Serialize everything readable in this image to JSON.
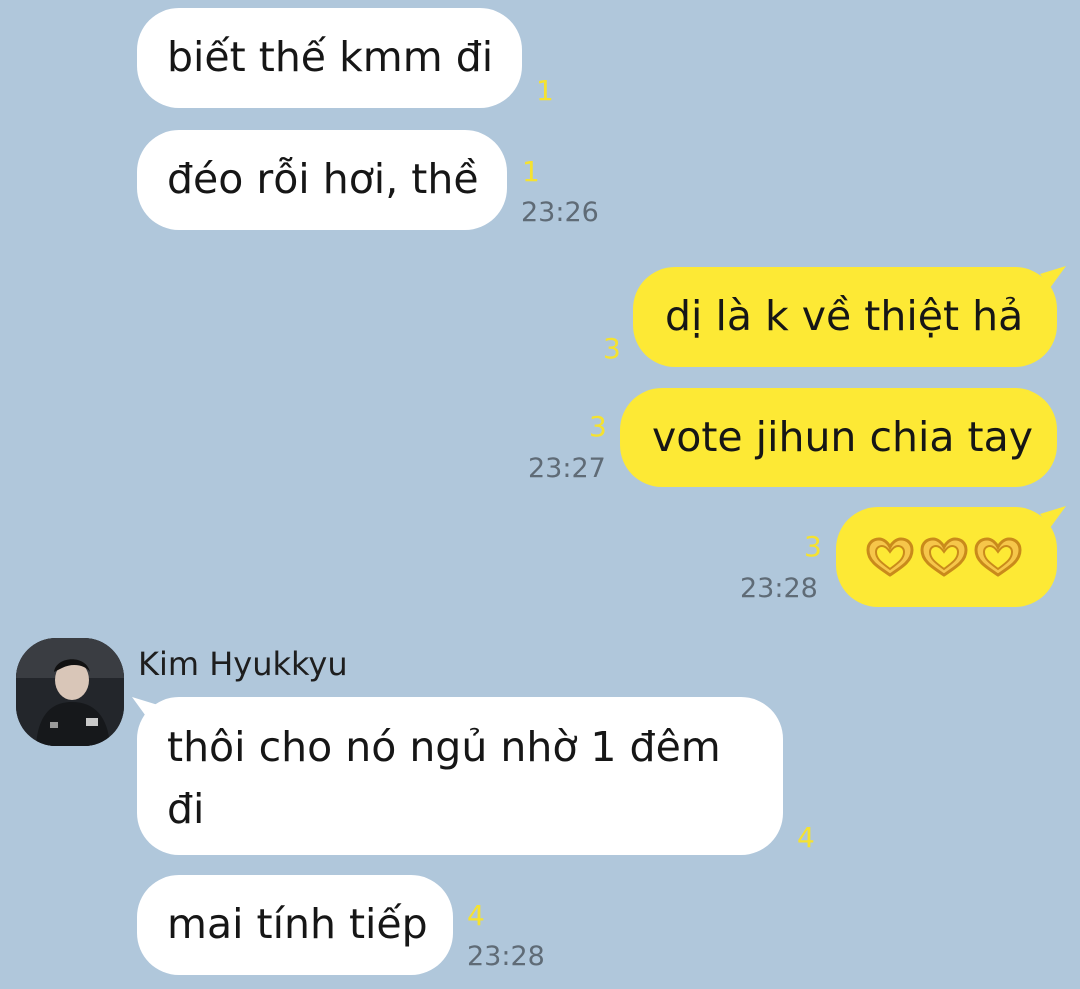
{
  "chat": {
    "messages": [
      {
        "text": "biết thế kmm đi",
        "unread": "1"
      },
      {
        "text": "đéo rỗi hơi, thề",
        "unread": "1",
        "time": "23:26"
      },
      {
        "text": "dị là k về thiệt hả",
        "unread": "3"
      },
      {
        "text": "vote jihun chia tay",
        "unread": "3",
        "time": "23:27"
      },
      {
        "emoji": "heart-hands-icon",
        "count": 3,
        "unread": "3",
        "time": "23:28"
      },
      {
        "sender": "Kim Hyukkyu",
        "text_line1": "thôi cho nó ngủ nhờ 1 đêm",
        "text_line2": "đi",
        "unread": "4"
      },
      {
        "text": "mai tính tiếp",
        "unread": "4",
        "time": "23:28"
      }
    ]
  },
  "colors": {
    "background": "#b0c7db",
    "incoming_bubble": "#ffffff",
    "outgoing_bubble": "#fde935",
    "unread_count": "#f5e230",
    "timestamp": "#5f6b76"
  }
}
